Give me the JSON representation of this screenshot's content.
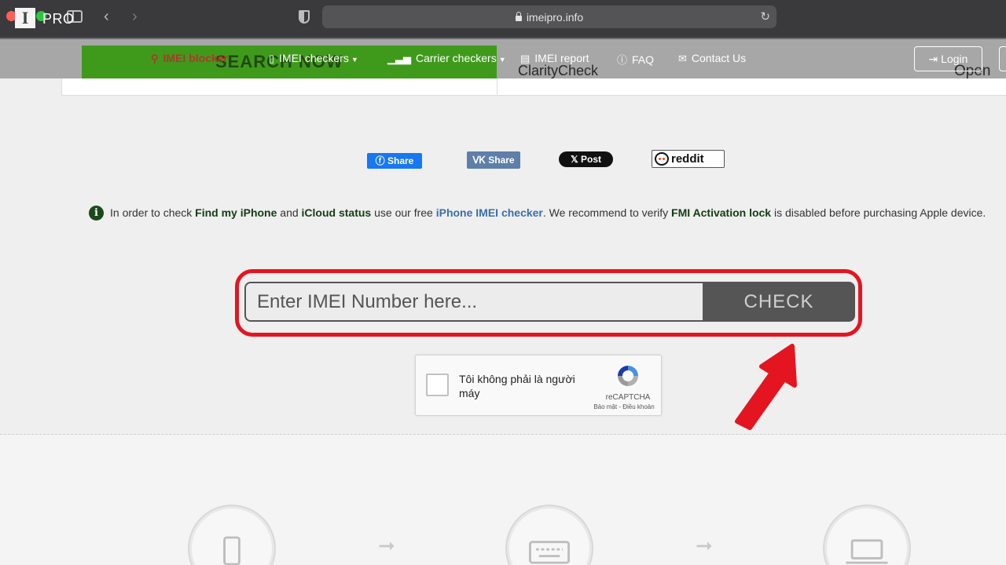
{
  "browser": {
    "url": "imeipro.info"
  },
  "nav": {
    "logo_letter": "I",
    "logo_text": "PRO",
    "items": [
      {
        "label": "IMEI blocker"
      },
      {
        "label": "IMEI checkers"
      },
      {
        "label": "Carrier checkers"
      },
      {
        "label": "IMEI report"
      },
      {
        "label": "FAQ"
      },
      {
        "label": "Contact Us"
      }
    ],
    "login_label": "Login"
  },
  "ad": {
    "search_now": "SEARCH NOW",
    "brand": "ClarityCheck",
    "open": "Open"
  },
  "share": {
    "facebook": "Share",
    "vk": "Share",
    "x": "Post",
    "reddit": "reddit"
  },
  "info": {
    "t1": "In order to check ",
    "b1": "Find my iPhone",
    "t2": " and ",
    "b2": "iCloud status",
    "t3": " use our free ",
    "link": "iPhone IMEI checker",
    "t4": ". We recommend to verify ",
    "b3": "FMI Activation lock",
    "t5": " is disabled before purchasing Apple device."
  },
  "search": {
    "placeholder": "Enter IMEI Number here...",
    "button": "CHECK"
  },
  "captcha": {
    "label": "Tôi không phải là người máy",
    "brand": "reCAPTCHA",
    "terms": "Bảo mật - Điều khoản"
  },
  "colors": {
    "highlight": "#e41521",
    "ad_green": "#3f9a1c",
    "nav_bg": "#a7a7a7",
    "check_button": "#555555"
  }
}
